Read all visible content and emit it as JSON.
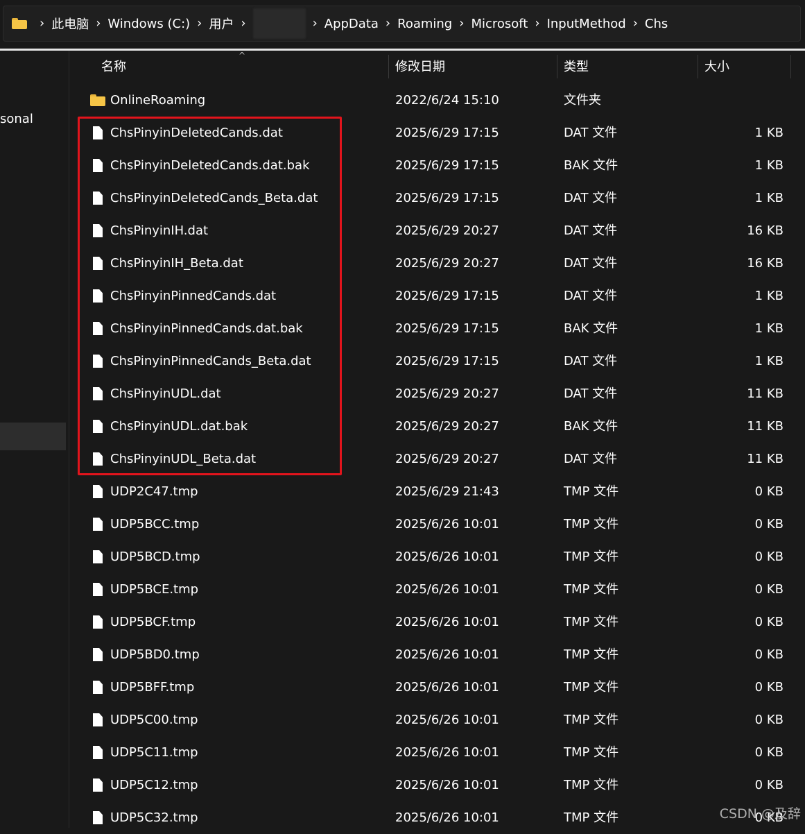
{
  "addressbar": {
    "crumbs": [
      "此电脑",
      "Windows (C:)",
      "用户",
      "AppData",
      "Roaming",
      "Microsoft",
      "InputMethod",
      "Chs"
    ],
    "separator": "›"
  },
  "nav": {
    "partial_label": "sonal"
  },
  "columns": {
    "name": "名称",
    "date": "修改日期",
    "type": "类型",
    "size": "大小",
    "sort_caret": "^"
  },
  "files": [
    {
      "name": "OnlineRoaming",
      "date": "2022/6/24 15:10",
      "type": "文件夹",
      "size": "",
      "kind": "folder"
    },
    {
      "name": "ChsPinyinDeletedCands.dat",
      "date": "2025/6/29 17:15",
      "type": "DAT 文件",
      "size": "1 KB",
      "kind": "file"
    },
    {
      "name": "ChsPinyinDeletedCands.dat.bak",
      "date": "2025/6/29 17:15",
      "type": "BAK 文件",
      "size": "1 KB",
      "kind": "file"
    },
    {
      "name": "ChsPinyinDeletedCands_Beta.dat",
      "date": "2025/6/29 17:15",
      "type": "DAT 文件",
      "size": "1 KB",
      "kind": "file"
    },
    {
      "name": "ChsPinyinIH.dat",
      "date": "2025/6/29 20:27",
      "type": "DAT 文件",
      "size": "16 KB",
      "kind": "file"
    },
    {
      "name": "ChsPinyinIH_Beta.dat",
      "date": "2025/6/29 20:27",
      "type": "DAT 文件",
      "size": "16 KB",
      "kind": "file"
    },
    {
      "name": "ChsPinyinPinnedCands.dat",
      "date": "2025/6/29 17:15",
      "type": "DAT 文件",
      "size": "1 KB",
      "kind": "file"
    },
    {
      "name": "ChsPinyinPinnedCands.dat.bak",
      "date": "2025/6/29 17:15",
      "type": "BAK 文件",
      "size": "1 KB",
      "kind": "file"
    },
    {
      "name": "ChsPinyinPinnedCands_Beta.dat",
      "date": "2025/6/29 17:15",
      "type": "DAT 文件",
      "size": "1 KB",
      "kind": "file"
    },
    {
      "name": "ChsPinyinUDL.dat",
      "date": "2025/6/29 20:27",
      "type": "DAT 文件",
      "size": "11 KB",
      "kind": "file"
    },
    {
      "name": "ChsPinyinUDL.dat.bak",
      "date": "2025/6/29 20:27",
      "type": "BAK 文件",
      "size": "11 KB",
      "kind": "file"
    },
    {
      "name": "ChsPinyinUDL_Beta.dat",
      "date": "2025/6/29 20:27",
      "type": "DAT 文件",
      "size": "11 KB",
      "kind": "file"
    },
    {
      "name": "UDP2C47.tmp",
      "date": "2025/6/29 21:43",
      "type": "TMP 文件",
      "size": "0 KB",
      "kind": "file"
    },
    {
      "name": "UDP5BCC.tmp",
      "date": "2025/6/26 10:01",
      "type": "TMP 文件",
      "size": "0 KB",
      "kind": "file"
    },
    {
      "name": "UDP5BCD.tmp",
      "date": "2025/6/26 10:01",
      "type": "TMP 文件",
      "size": "0 KB",
      "kind": "file"
    },
    {
      "name": "UDP5BCE.tmp",
      "date": "2025/6/26 10:01",
      "type": "TMP 文件",
      "size": "0 KB",
      "kind": "file"
    },
    {
      "name": "UDP5BCF.tmp",
      "date": "2025/6/26 10:01",
      "type": "TMP 文件",
      "size": "0 KB",
      "kind": "file"
    },
    {
      "name": "UDP5BD0.tmp",
      "date": "2025/6/26 10:01",
      "type": "TMP 文件",
      "size": "0 KB",
      "kind": "file"
    },
    {
      "name": "UDP5BFF.tmp",
      "date": "2025/6/26 10:01",
      "type": "TMP 文件",
      "size": "0 KB",
      "kind": "file"
    },
    {
      "name": "UDP5C00.tmp",
      "date": "2025/6/26 10:01",
      "type": "TMP 文件",
      "size": "0 KB",
      "kind": "file"
    },
    {
      "name": "UDP5C11.tmp",
      "date": "2025/6/26 10:01",
      "type": "TMP 文件",
      "size": "0 KB",
      "kind": "file"
    },
    {
      "name": "UDP5C12.tmp",
      "date": "2025/6/26 10:01",
      "type": "TMP 文件",
      "size": "0 KB",
      "kind": "file"
    },
    {
      "name": "UDP5C32.tmp",
      "date": "2025/6/26 10:01",
      "type": "TMP 文件",
      "size": "0 KB",
      "kind": "file"
    }
  ],
  "watermark": "CSDN @及辞",
  "colors": {
    "background": "#191919",
    "highlight_box": "#e2141c",
    "folder": "#f6c546"
  }
}
